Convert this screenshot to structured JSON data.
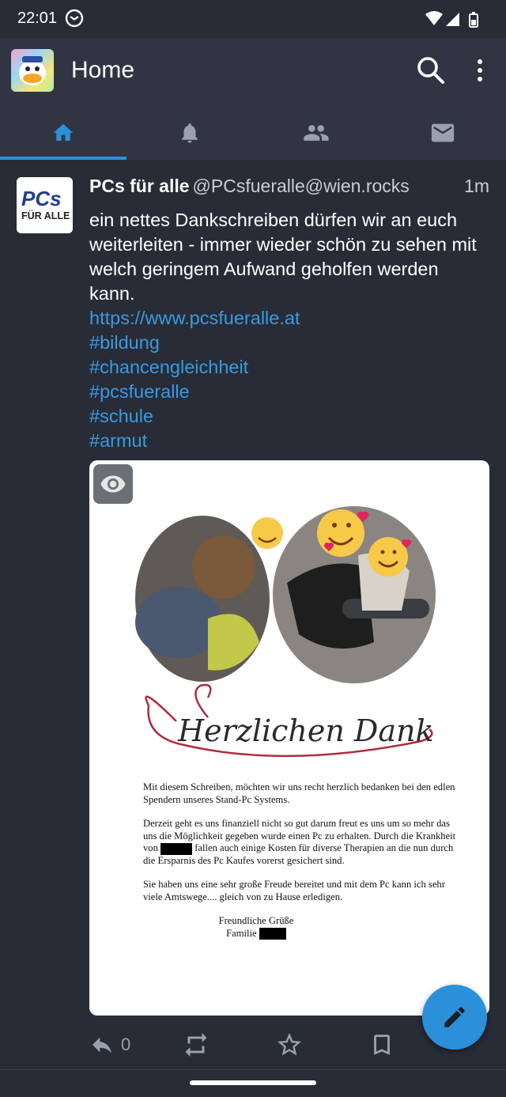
{
  "status_bar": {
    "time": "22:01",
    "network_badge": "4",
    "icons": [
      "notification-icon",
      "wifi-icon",
      "signal-icon",
      "battery-icon"
    ]
  },
  "app_bar": {
    "title": "Home",
    "actions": [
      "search-icon",
      "more-vert-icon"
    ]
  },
  "tabs": [
    {
      "icon": "home-icon",
      "active": true
    },
    {
      "icon": "bell-icon",
      "active": false
    },
    {
      "icon": "people-icon",
      "active": false
    },
    {
      "icon": "mail-icon",
      "active": false
    }
  ],
  "post": {
    "display_name": "PCs für alle",
    "acct": "@PCsfueralle@wien.rocks",
    "time": "1m",
    "avatar_text": {
      "line1": "PCs",
      "line2": "FÜR ALLE"
    },
    "text": "ein nettes Dankschreiben dürfen wir an euch weiterleiten - immer wieder schön zu sehen mit welch geringem Aufwand geholfen werden kann.",
    "link": "https://www.pcsfueralle.at",
    "hashtags": [
      "#bildung",
      "#chancengleichheit",
      "#pcsfueralle",
      "#schule",
      "#armut"
    ],
    "media": {
      "title": "Herzlichen Dank",
      "p1": "Mit diesem Schreiben, möchten wir uns recht herzlich bedanken bei den edlen Spendern unseres Stand-Pc Systems.",
      "p2_a": "Derzeit geht es uns finanziell nicht so gut darum freut es uns um so mehr das uns die Möglichkeit gegeben wurde einen Pc zu erhalten. Durch die Krankheit von",
      "p2_b": "fallen auch einige Kosten für diverse Therapien an die nun durch die Ersparnis des Pc Kaufes vorerst gesichert sind.",
      "p3": "Sie haben uns eine sehr große Freude bereitet und mit dem Pc kann ich sehr viele Amtswege.... gleich von zu Hause erledigen.",
      "closing": "Freundliche Grüße",
      "family": "Familie"
    },
    "reply_count": "0"
  },
  "colors": {
    "background": "#282c37",
    "bar": "#313543",
    "accent": "#2b90d9",
    "link": "#3a9ae0"
  }
}
